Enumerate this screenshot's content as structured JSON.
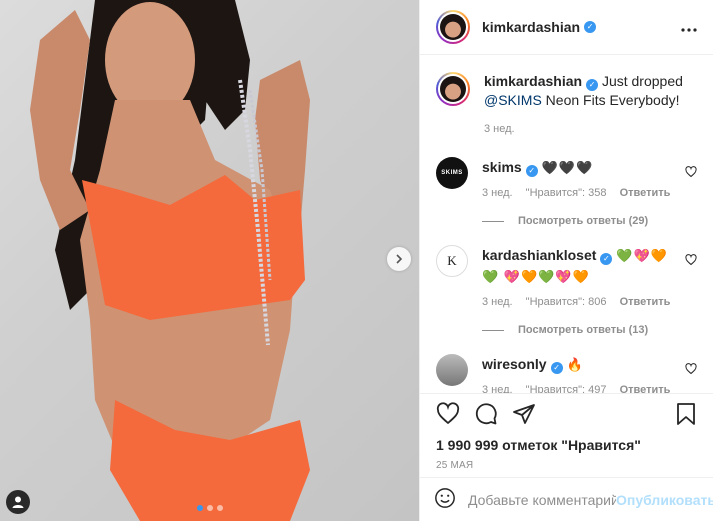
{
  "post": {
    "username": "kimkardashian",
    "caption_username": "kimkardashian",
    "caption_text": "Just dropped",
    "caption_mention": "@SKIMS",
    "caption_rest": "Neon Fits Everybody!",
    "caption_age": "3 нед."
  },
  "comments": [
    {
      "username": "skims",
      "avatar_text": "SKIMS",
      "emoji": "🖤🖤🖤",
      "age": "3 нед.",
      "likes": "\"Нравится\": 358",
      "reply": "Ответить",
      "view_replies": "Посмотреть ответы (29)"
    },
    {
      "username": "kardashiankloset",
      "avatar_text": "K",
      "emoji": "💚💖🧡💚 💖🧡💚💖🧡",
      "age": "3 нед.",
      "likes": "\"Нравится\": 806",
      "reply": "Ответить",
      "view_replies": "Посмотреть ответы (13)"
    },
    {
      "username": "wiresonly",
      "emoji": "🔥",
      "age": "3 нед.",
      "likes": "\"Нравится\": 497",
      "reply": "Ответить"
    }
  ],
  "actions": {
    "likes_text": "1 990 999 отметок \"Нравится\"",
    "date": "25 мая"
  },
  "composer": {
    "placeholder": "Добавьте комментарий...",
    "publish_label": "Опубликовать"
  },
  "carousel": {
    "slides": 3,
    "active": 1
  },
  "colors": {
    "accent": "#3897f0",
    "swimsuit": "#f46a3c",
    "publish_disabled": "#b2dffc"
  },
  "icons": [
    "chevron-right-icon",
    "user-tag-icon",
    "more-icon",
    "heart-icon",
    "comment-icon",
    "share-icon",
    "bookmark-icon",
    "emoji-icon",
    "verified-icon"
  ]
}
